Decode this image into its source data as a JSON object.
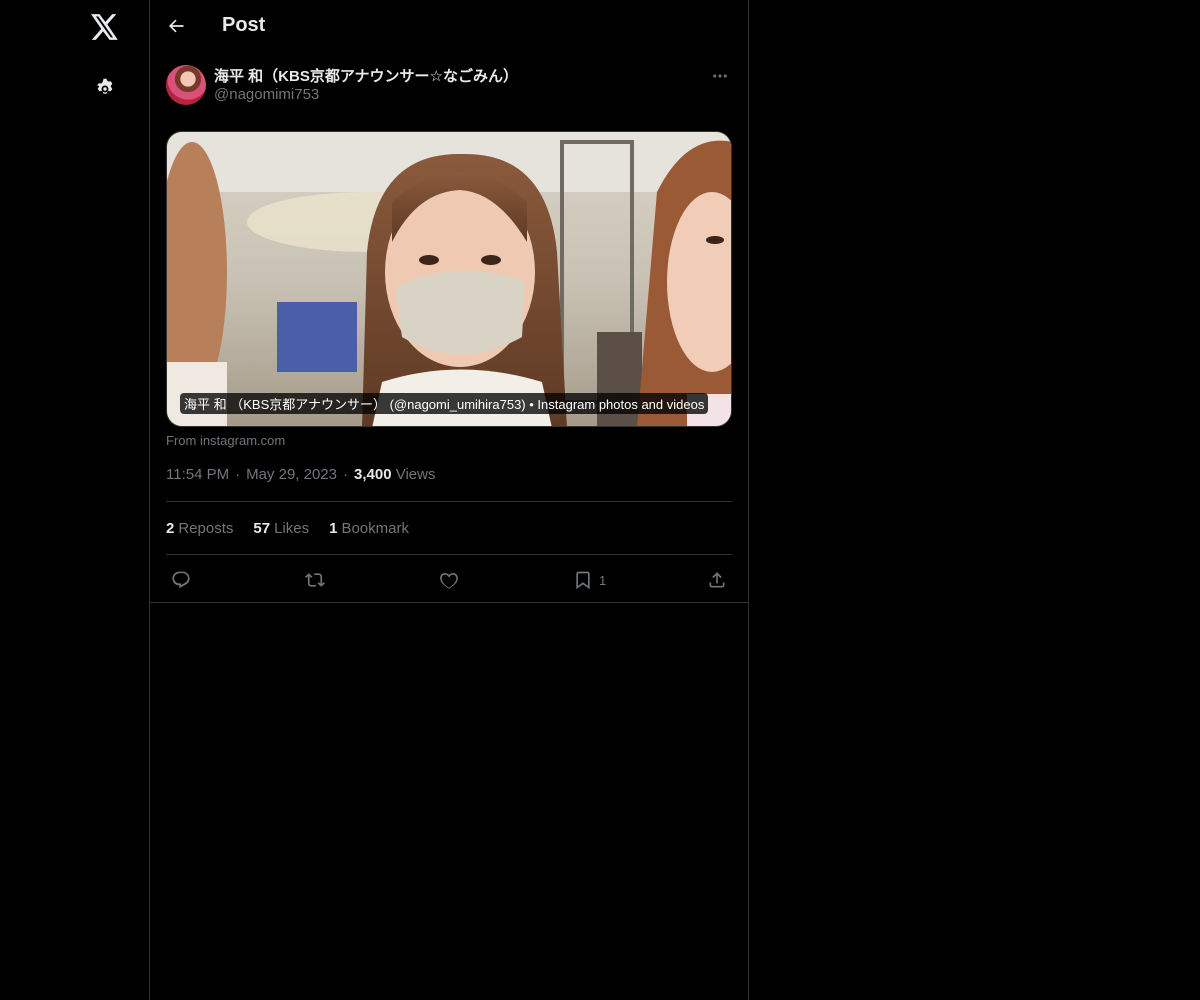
{
  "nav": {
    "logo_icon": "x-logo-icon",
    "settings_icon": "gear-icon"
  },
  "header": {
    "back_icon": "arrow-left-icon",
    "title": "Post"
  },
  "post": {
    "author": {
      "name": "海平 和（KBS京都アナウンサー☆なごみん）",
      "handle": "@nagomimi753"
    },
    "more_icon": "more-horizontal-icon",
    "card": {
      "caption": "海平 和 （KBS京都アナウンサー） (@nagomi_umihira753) • Instagram photos and videos",
      "source": "From instagram.com"
    },
    "meta": {
      "time": "11:54 PM",
      "date": "May 29, 2023",
      "views_count": "3,400",
      "views_label": "Views",
      "separator": "·"
    },
    "stats": {
      "reposts_count": "2",
      "reposts_label": "Reposts",
      "likes_count": "57",
      "likes_label": "Likes",
      "bookmarks_count": "1",
      "bookmarks_label": "Bookmark"
    },
    "actions": {
      "reply_icon": "reply-icon",
      "repost_icon": "repost-icon",
      "like_icon": "heart-icon",
      "bookmark_icon": "bookmark-icon",
      "bookmark_count": "1",
      "share_icon": "share-icon"
    }
  },
  "colors": {
    "background": "#000000",
    "text": "#e7e9ea",
    "muted": "#71767b",
    "border": "#2f3336"
  }
}
